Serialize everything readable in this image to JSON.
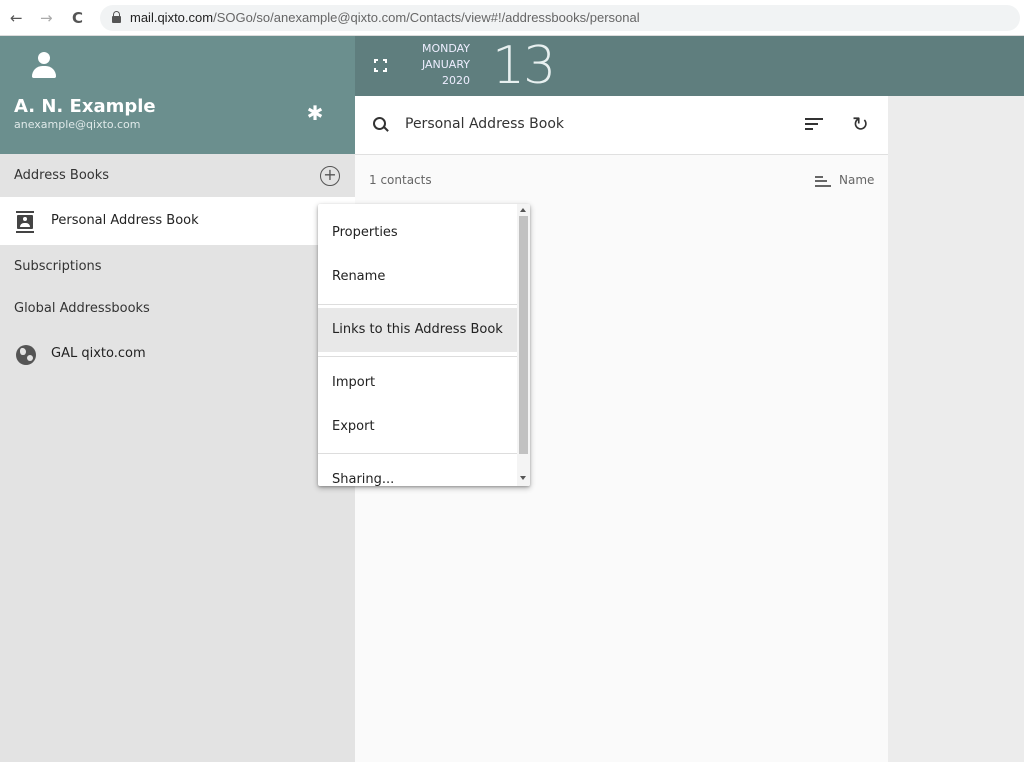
{
  "browser": {
    "back_glyph": "←",
    "forward_glyph": "→",
    "reload_glyph": "C",
    "url_host": "mail.qixto.com",
    "url_path": "/SOGo/so/anexample@qixto.com/Contacts/view#!/addressbooks/personal"
  },
  "user": {
    "name": "A. N. Example",
    "email": "anexample@qixto.com",
    "settings_glyph": "✱"
  },
  "sidebar": {
    "address_books_label": "Address Books",
    "add_glyph": "+",
    "personal_book": "Personal Address Book",
    "subscriptions_label": "Subscriptions",
    "global_label": "Global Addressbooks",
    "gal_book": "GAL qixto.com"
  },
  "date": {
    "weekday": "MONDAY",
    "month": "JANUARY",
    "year": "2020",
    "day": "13"
  },
  "main": {
    "title": "Personal Address Book",
    "refresh_glyph": "↻",
    "contacts_count": "1 contacts",
    "sort_label": "Name"
  },
  "context_menu": {
    "items": [
      {
        "label": "Properties"
      },
      {
        "label": "Rename"
      },
      {
        "label": "Links to this Address Book"
      },
      {
        "label": "Import"
      },
      {
        "label": "Export"
      },
      {
        "label": "Sharing..."
      }
    ]
  },
  "colors": {
    "header_teal": "#6b8f8e",
    "date_teal": "#5f7e7e",
    "sidebar_bg": "#e3e3e3"
  }
}
